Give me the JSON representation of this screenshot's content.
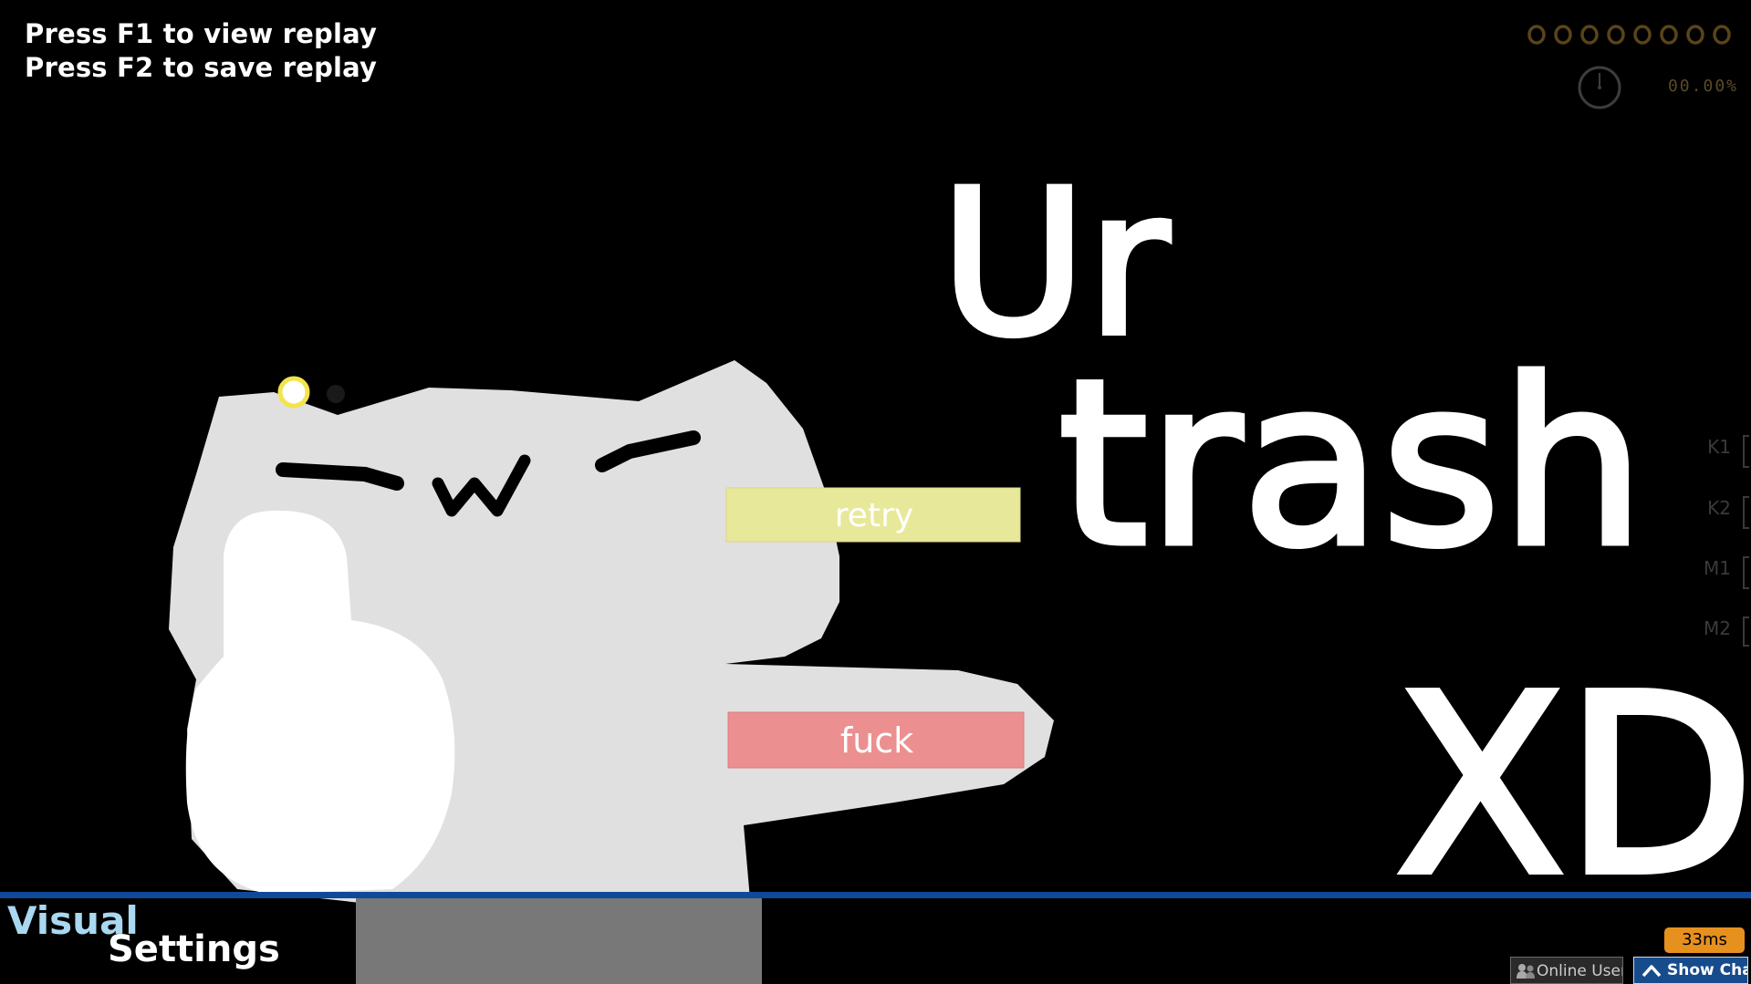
{
  "hud": {
    "replay_hint_view": "Press F1 to view replay",
    "replay_hint_save": "Press F2 to save replay",
    "accuracy": "00.00%",
    "score_digits": "00000000"
  },
  "pause_menu": {
    "retry_label": "retry",
    "quit_label": "fuck"
  },
  "skin_text": {
    "line1": "Ur",
    "line2": "trash",
    "line3": "XD"
  },
  "key_overlay": [
    "K1",
    "K2",
    "M1",
    "M2"
  ],
  "footer": {
    "section_word1": "Visual",
    "section_word2": "Settings",
    "ping": "33ms",
    "online_users": "Online Users",
    "show_chat": "Show Chat"
  },
  "colors": {
    "retry_button": "#e8e89a",
    "quit_button": "#ec8f90",
    "accent_bar": "#0f4a9a",
    "ping_badge": "#e6901e"
  }
}
